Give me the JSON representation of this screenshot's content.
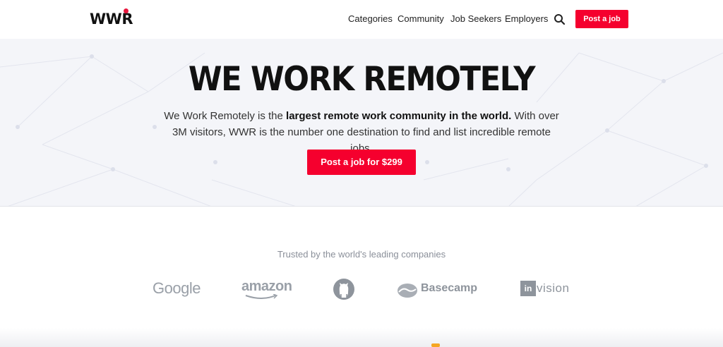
{
  "header": {
    "logo": "WWR",
    "nav": [
      "Categories",
      "Community",
      "Job Seekers",
      "Employers"
    ],
    "post_job": "Post a job"
  },
  "hero": {
    "title": "WE WORK REMOTELY",
    "desc_pre": "We Work Remotely is the ",
    "desc_bold": "largest remote work community in the world.",
    "desc_post": " With over 3M visitors, WWR is the number one destination to find and list incredible remote jobs.",
    "cta": "Post a job for $299"
  },
  "trusted": {
    "label": "Trusted by the world's leading companies",
    "companies": [
      "Google",
      "amazon",
      "Basecamp",
      "in",
      "vision"
    ]
  },
  "colors": {
    "accent": "#f5002e",
    "logo_dot": "#e8173d",
    "hero_bg": "#f4f5f9"
  }
}
